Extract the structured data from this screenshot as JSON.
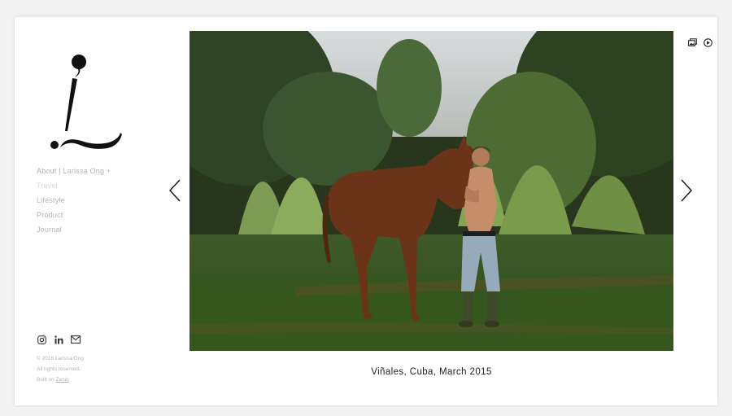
{
  "logo": {
    "mark": "L",
    "icon": "logo-mark"
  },
  "nav": {
    "items": [
      {
        "label": "About | Larissa Ong +"
      },
      {
        "label": "Travel"
      },
      {
        "label": "Lifestyle"
      },
      {
        "label": "Product"
      },
      {
        "label": "Journal"
      }
    ]
  },
  "social": {
    "icons": [
      "instagram-icon",
      "linkedin-icon",
      "mail-icon"
    ]
  },
  "footer": {
    "copyright": "© 2016 Larissa Ong",
    "rights": "All rights reserved.",
    "built_on": "Built on",
    "platform": "Zenjo"
  },
  "gallery": {
    "caption": "Viñales, Cuba, March 2015",
    "photo_alt": "Boy standing with a brown horse in a green field",
    "prev_icon": "chevron-left-icon",
    "next_icon": "chevron-right-icon",
    "top_icons": [
      "gallery-icon",
      "play-icon"
    ]
  },
  "colors": {
    "background": "#f2f2f2",
    "panel": "#ffffff",
    "nav_text": "#b3b3b3",
    "caption": "#222222"
  }
}
